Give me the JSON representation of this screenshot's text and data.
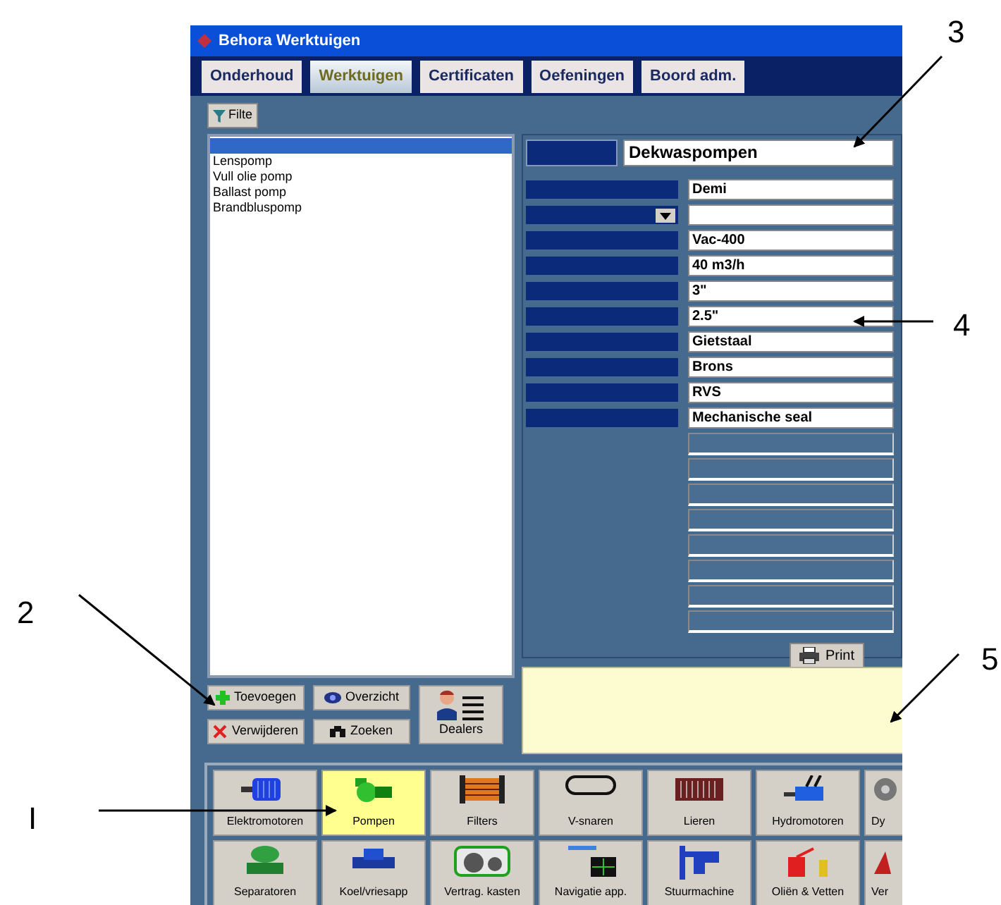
{
  "window": {
    "title": "Behora Werktuigen"
  },
  "tabs": [
    {
      "label": "Onderhoud",
      "selected": false
    },
    {
      "label": "Werktuigen",
      "selected": true
    },
    {
      "label": "Certificaten",
      "selected": false
    },
    {
      "label": "Oefeningen",
      "selected": false
    },
    {
      "label": "Boord adm.",
      "selected": false
    }
  ],
  "toolbar": {
    "filter_button": "Filte"
  },
  "list": {
    "items": [
      {
        "selected": true
      },
      {
        "label": "Lenspomp",
        "selected": false
      },
      {
        "label": "Vull olie pomp",
        "selected": false
      },
      {
        "label": "Ballast pomp",
        "selected": false
      },
      {
        "label": "Brandbluspomp",
        "selected": false
      }
    ]
  },
  "details": {
    "name_value": "Dekwaspompen",
    "fields": [
      {
        "kind": "text",
        "value": "Demi"
      },
      {
        "kind": "dropdown"
      },
      {
        "kind": "text",
        "value": "Vac-400"
      },
      {
        "kind": "text",
        "value": "40 m3/h"
      },
      {
        "kind": "text",
        "value": "3\""
      },
      {
        "kind": "text",
        "value": "2.5\""
      },
      {
        "kind": "text",
        "value": "Gietstaal"
      },
      {
        "kind": "text",
        "value": "Brons"
      },
      {
        "kind": "text",
        "value": "RVS"
      },
      {
        "kind": "text",
        "value": "Mechanische seal"
      },
      {
        "kind": "blank"
      },
      {
        "kind": "blank"
      },
      {
        "kind": "blank"
      },
      {
        "kind": "blank"
      },
      {
        "kind": "blank"
      },
      {
        "kind": "blank"
      },
      {
        "kind": "blank"
      },
      {
        "kind": "blank"
      }
    ],
    "print_button": "Print"
  },
  "actions": [
    {
      "label": "Toevoegen",
      "kind": "add"
    },
    {
      "label": "Overzicht",
      "kind": "view"
    },
    {
      "label": "Verwijderen",
      "kind": "delete"
    },
    {
      "label": "Zoeken",
      "kind": "search"
    }
  ],
  "dealers_button": "Dealers",
  "categories": [
    {
      "label": "Elektromotoren",
      "selected": false
    },
    {
      "label": "Pompen",
      "selected": true
    },
    {
      "label": "Filters",
      "selected": false
    },
    {
      "label": "V-snaren",
      "selected": false
    },
    {
      "label": "Lieren",
      "selected": false
    },
    {
      "label": "Hydromotoren",
      "selected": false
    },
    {
      "label": "Dy",
      "selected": false
    },
    {
      "label": "Separatoren",
      "selected": false
    },
    {
      "label": "Koel/vriesapp",
      "selected": false
    },
    {
      "label": "Vertrag. kasten",
      "selected": false
    },
    {
      "label": "Navigatie app.",
      "selected": false
    },
    {
      "label": "Stuurmachine",
      "selected": false
    },
    {
      "label": "Oliën & Vetten",
      "selected": false
    },
    {
      "label": "Ver",
      "selected": false
    }
  ],
  "annotations": [
    {
      "label": "3"
    },
    {
      "label": "4"
    },
    {
      "label": "2"
    },
    {
      "label": "5"
    },
    {
      "label": "I"
    }
  ]
}
